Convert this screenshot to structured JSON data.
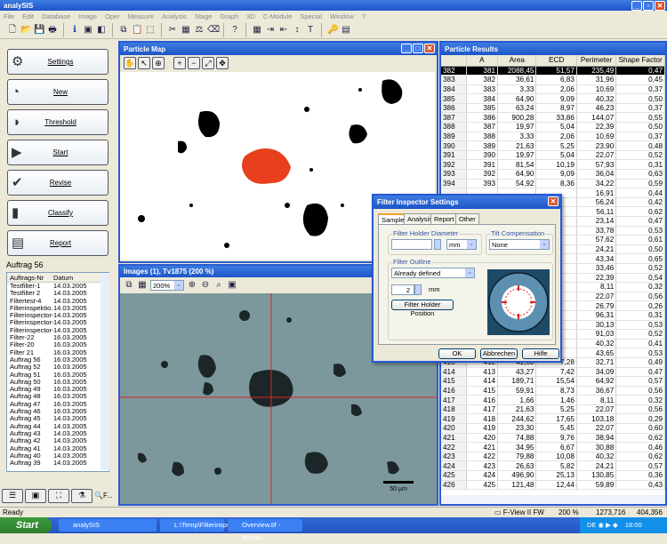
{
  "app": {
    "title": "analySIS"
  },
  "menu": [
    "File",
    "Edit",
    "Database",
    "Image",
    "Oper",
    "Measure",
    "Analysis",
    "Stage",
    "Graph",
    "3D",
    "C-Module",
    "Special",
    "Window",
    "?"
  ],
  "left": {
    "buttons": [
      {
        "label": "Settings",
        "icon": "settings-icon"
      },
      {
        "label": "New",
        "icon": "new-icon"
      },
      {
        "label": "Threshold",
        "icon": "threshold-icon"
      },
      {
        "label": "Start",
        "icon": "start-icon"
      },
      {
        "label": "Revise",
        "icon": "revise-icon"
      },
      {
        "label": "Classify",
        "icon": "classify-icon"
      },
      {
        "label": "Report",
        "icon": "report-icon"
      }
    ],
    "order_label": "Auftrag 56",
    "list_headers": [
      "Auftrags-Nr",
      "Datum"
    ],
    "list": [
      [
        "Testfilter-1",
        "14.03.2005"
      ],
      [
        "Testfilter 2",
        "14.03.2005"
      ],
      [
        "Filtertest-4",
        "14.03.2005"
      ],
      [
        "Filterinspektio...",
        "14.03.2005"
      ],
      [
        "Filterinspector-6",
        "14.03.2005"
      ],
      [
        "Filterinspector-5",
        "14.03.2005"
      ],
      [
        "Filterinspector-4",
        "14.03.2005"
      ],
      [
        "Filter-22",
        "16.03.2005"
      ],
      [
        "Filter-20",
        "16.03.2005"
      ],
      [
        "Filter 21",
        "16.03.2005"
      ],
      [
        "Auftrag 56",
        "16.03.2005"
      ],
      [
        "Auftrag 52",
        "16.03.2005"
      ],
      [
        "Auftrag 51",
        "16.03.2005"
      ],
      [
        "Auftrag 50",
        "16.03.2005"
      ],
      [
        "Auftrag 49",
        "16.03.2005"
      ],
      [
        "Auftrag 48",
        "16.03.2005"
      ],
      [
        "Auftrag 47",
        "16.03.2005"
      ],
      [
        "Auftrag 46",
        "16.03.2005"
      ],
      [
        "Auftrag 45",
        "14.03.2005"
      ],
      [
        "Auftrag 44",
        "14.03.2005"
      ],
      [
        "Auftrag 43",
        "14.03.2005"
      ],
      [
        "Auftrag 42",
        "14.03.2005"
      ],
      [
        "Auftrag 41",
        "14.03.2005"
      ],
      [
        "Auftrag 40",
        "14.03.2005"
      ],
      [
        "Auftrag 39",
        "14.03.2005"
      ]
    ],
    "bottom_tab_label": "F..."
  },
  "particle_map": {
    "title": "Particle Map"
  },
  "images": {
    "title": "Images (1), Tv1875 (200 %)",
    "zoom": "200%",
    "scale_label": "50 µm"
  },
  "results": {
    "title": "Particle Results",
    "headers": [
      "",
      "A",
      "Area",
      "ECD",
      "Perimeter",
      "Shape Factor"
    ],
    "rows": [
      [
        "382",
        "381",
        "2088,45",
        "51,57",
        "235,49",
        "0,47"
      ],
      [
        "383",
        "382",
        "36,61",
        "6,83",
        "31,96",
        "0,45"
      ],
      [
        "384",
        "383",
        "3,33",
        "2,06",
        "10,69",
        "0,37"
      ],
      [
        "385",
        "384",
        "64,90",
        "9,09",
        "40,32",
        "0,50"
      ],
      [
        "386",
        "385",
        "63,24",
        "8,97",
        "46,23",
        "0,37"
      ],
      [
        "387",
        "386",
        "900,28",
        "33,86",
        "144,07",
        "0,55"
      ],
      [
        "388",
        "387",
        "19,97",
        "5,04",
        "22,39",
        "0,50"
      ],
      [
        "389",
        "388",
        "3,33",
        "2,06",
        "10,69",
        "0,37"
      ],
      [
        "390",
        "389",
        "21,63",
        "5,25",
        "23,90",
        "0,48"
      ],
      [
        "391",
        "390",
        "19,97",
        "5,04",
        "22,07",
        "0,52"
      ],
      [
        "392",
        "391",
        "81,54",
        "10,19",
        "57,93",
        "0,31"
      ],
      [
        "393",
        "392",
        "64,90",
        "9,09",
        "36,04",
        "0,63"
      ],
      [
        "394",
        "393",
        "54,92",
        "8,36",
        "34,22",
        "0,59"
      ],
      [
        "",
        "",
        "",
        "",
        "16,91",
        "0,44"
      ],
      [
        "",
        "",
        "",
        "",
        "56,24",
        "0,42"
      ],
      [
        "",
        "",
        "",
        "",
        "56,11",
        "0,62"
      ],
      [
        "",
        "",
        "",
        "",
        "23,14",
        "0,47"
      ],
      [
        "",
        "",
        "",
        "",
        "33,78",
        "0,53"
      ],
      [
        "",
        "",
        "",
        "",
        "57,62",
        "0,61"
      ],
      [
        "",
        "",
        "",
        "",
        "24,21",
        "0,50"
      ],
      [
        "",
        "",
        "",
        "",
        "43,34",
        "0,65"
      ],
      [
        "",
        "",
        "",
        "",
        "33,46",
        "0,52"
      ],
      [
        "",
        "",
        "",
        "",
        "22,39",
        "0,54"
      ],
      [
        "",
        "",
        "",
        "",
        "8,11",
        "0,32"
      ],
      [
        "",
        "",
        "",
        "",
        "22,07",
        "0,56"
      ],
      [
        "",
        "",
        "",
        "",
        "26,79",
        "0,26"
      ],
      [
        "",
        "",
        "",
        "",
        "96,31",
        "0,31"
      ],
      [
        "",
        "",
        "",
        "",
        "30,13",
        "0,53"
      ],
      [
        "",
        "",
        "",
        "",
        "91,03",
        "0,52"
      ],
      [
        "",
        "",
        "",
        "",
        "40,32",
        "0,41"
      ],
      [
        "",
        "",
        "",
        "",
        "43,65",
        "0,53"
      ],
      [
        "413",
        "412",
        "41,60",
        "7,28",
        "32,71",
        "0,49"
      ],
      [
        "414",
        "413",
        "43,27",
        "7,42",
        "34,09",
        "0,47"
      ],
      [
        "415",
        "414",
        "189,71",
        "15,54",
        "64,92",
        "0,57"
      ],
      [
        "416",
        "415",
        "59,91",
        "8,73",
        "36,67",
        "0,56"
      ],
      [
        "417",
        "416",
        "1,66",
        "1,46",
        "8,11",
        "0,32"
      ],
      [
        "418",
        "417",
        "21,63",
        "5,25",
        "22,07",
        "0,56"
      ],
      [
        "419",
        "418",
        "244,62",
        "17,65",
        "103,18",
        "0,29"
      ],
      [
        "420",
        "419",
        "23,30",
        "5,45",
        "22,07",
        "0,60"
      ],
      [
        "421",
        "420",
        "74,88",
        "9,76",
        "38,94",
        "0,62"
      ],
      [
        "422",
        "421",
        "34,95",
        "6,67",
        "30,88",
        "0,46"
      ],
      [
        "423",
        "422",
        "79,88",
        "10,08",
        "40,32",
        "0,62"
      ],
      [
        "424",
        "423",
        "26,63",
        "5,82",
        "24,21",
        "0,57"
      ],
      [
        "425",
        "424",
        "496,90",
        "25,13",
        "130,85",
        "0,36"
      ],
      [
        "426",
        "425",
        "121,48",
        "12,44",
        "59,89",
        "0,43"
      ]
    ]
  },
  "dialog": {
    "title": "Filter Inspector Settings",
    "tabs": [
      "Sample",
      "Analysis",
      "Report",
      "Other"
    ],
    "holder_diameter_label": "Filter Holder Diameter",
    "holder_unit": "mm",
    "tilt_label": "Tilt Compensation",
    "tilt_value": "None",
    "outline_label": "Filter Outline",
    "outline_value": "Already defined",
    "outline_width": "2",
    "outline_unit": "mm",
    "position_button": "Filter Holder Position",
    "ok": "OK",
    "cancel": "Abbrechen",
    "help": "Hilfe"
  },
  "status": {
    "text": "Ready",
    "camera": "F-View II FW",
    "zoom": "200 %",
    "x": "1273,716",
    "y": "404,356"
  },
  "taskbar": {
    "start": "Start",
    "tasks": [
      "analySIS",
      "L:\\Temp\\Filterinspect...",
      "Overview.tif - Windo..."
    ],
    "lang": "DE",
    "clock": "18:00"
  }
}
